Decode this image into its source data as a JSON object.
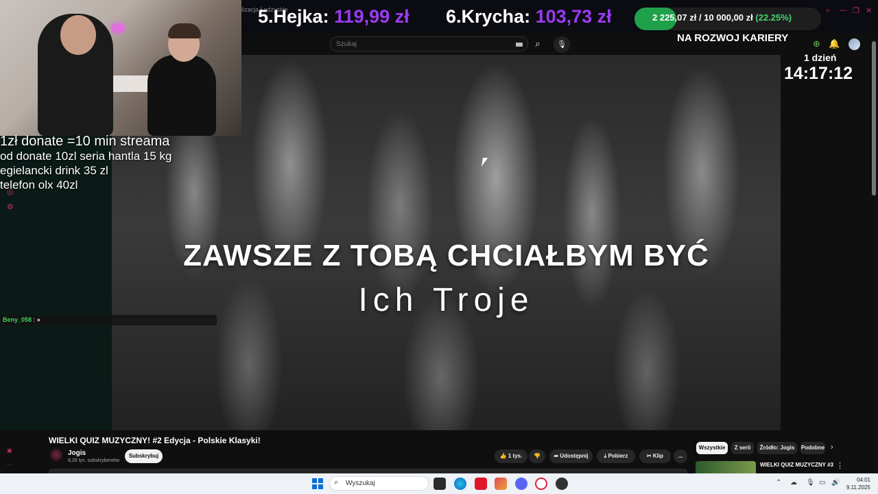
{
  "stream": {
    "tab_fragment": "lizacja Łodzyskie",
    "ranks": [
      {
        "label": "5.Hejka:",
        "amount": "119,99 zł"
      },
      {
        "label": "6.Krycha:",
        "amount": "103,73 zł"
      }
    ],
    "goal": {
      "current": "2 225,07 zł",
      "separator": "/",
      "target": "10 000,00 zł",
      "percent_text": "(22.25%)",
      "progress": 0.2225
    },
    "goal_label": "NA ROZWOJ KARIERY",
    "timer_day": "1 dzień",
    "timer": "14:17:12",
    "donate_lines": [
      "1zł donate =10 min streama",
      "od donate 10zl seria hantla 15 kg",
      "egielancki drink 35 zl",
      "telefon olx 40zl"
    ],
    "chat": {
      "user": "Beny_058",
      "sep": ":"
    }
  },
  "youtube": {
    "search_placeholder": "Szukaj",
    "video_overlay_title": "ZAWSZE Z TOBĄ CHCIAŁBYM BYĆ",
    "video_overlay_artist": "Ich Troje",
    "video_title": "WIELKI QUIZ MUZYCZNY! #2 Edycja - Polskie Klasyki!",
    "channel": {
      "name": "Jogis",
      "subs": "8,26 tys. subskrybentów",
      "subscribe_label": "Subskrybuj"
    },
    "actions": {
      "likes": "1 tys.",
      "share": "Udostępnij",
      "download": "Pobierz",
      "clip": "Klip",
      "more": "..."
    },
    "chips": [
      "Wszystkie",
      "Z serii",
      "Źródło: Jogis",
      "Podobne"
    ],
    "recommended_title": "WIELKI QUIZ MUZYCZNY #3"
  },
  "taskbar": {
    "search_placeholder": "Wyszukaj",
    "time": "04:01",
    "date": "9.11.2025"
  },
  "colors": {
    "accent_purple": "#9b3cf0",
    "goal_green": "#1fa14a",
    "chat_user": "#39d65a"
  }
}
